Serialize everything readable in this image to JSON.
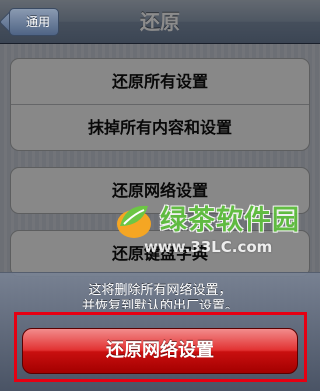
{
  "navbar": {
    "back_label": "通用",
    "title": "还原"
  },
  "groups": [
    {
      "items": [
        "还原所有设置",
        "抹掉所有内容和设置"
      ]
    },
    {
      "items": [
        "还原网络设置"
      ]
    },
    {
      "items": [
        "还原键盘字典"
      ]
    }
  ],
  "action_sheet": {
    "message_line1": "这将删除所有网络设置，",
    "message_line2": "并恢复到默认的出厂设置。",
    "confirm_label": "还原网络设置"
  },
  "watermark": {
    "title": "绿茶软件园",
    "url": "www.33LC.com"
  },
  "colors": {
    "navbar": "#7f90a8",
    "destructive": "#d41f1f",
    "highlight": "#e60012",
    "watermark_green": "#5ec33c"
  }
}
